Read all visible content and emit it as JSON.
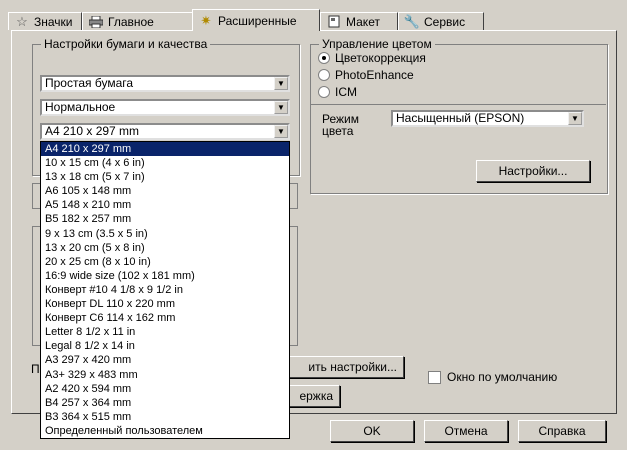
{
  "tabs": [
    {
      "label": "Значки",
      "icon": "star-icon"
    },
    {
      "label": "Главное",
      "icon": "printer-icon"
    },
    {
      "label": "Расширенные",
      "icon": "sparkle-icon"
    },
    {
      "label": "Макет",
      "icon": "page-layout-icon"
    },
    {
      "label": "Сервис",
      "icon": "wrench-icon"
    }
  ],
  "paper_group": {
    "title": "Настройки бумаги и качества",
    "media_type": "Простая бумага",
    "quality": "Нормальное",
    "paper_size": "A4 210 x 297 mm"
  },
  "color_group": {
    "title": "Управление цветом",
    "options": [
      "Цветокоррекция",
      "PhotoEnhance",
      "ICM"
    ],
    "selected": "Цветокоррекция",
    "mode_label_1": "Режим",
    "mode_label_2": "цвета",
    "mode_value": "Насыщенный (EPSON)",
    "settings_button": "Настройки..."
  },
  "paper_size_options": [
    "A4 210 x 297 mm",
    "10 x 15 cm (4 x 6 in)",
    "13 x 18 cm (5 x 7 in)",
    "A6 105 x 148 mm",
    "A5 148 x 210 mm",
    "B5 182 x 257 mm",
    "9 x 13 cm (3.5 x 5 in)",
    "13 x 20 cm (5 x 8 in)",
    "20 x 25 cm (8 x 10 in)",
    "16:9 wide size (102 x 181 mm)",
    "Конверт #10 4 1/8 x 9 1/2 in",
    "Конверт DL  110 x 220 mm",
    "Конверт C6  114 x 162 mm",
    "Letter 8 1/2 x 11 in",
    "Legal 8 1/2 x 14 in",
    "A3 297 x 420 mm",
    "A3+ 329 x 483 mm",
    "A2 420 x 594 mm",
    "B4 257 x 364 mm",
    "B3 364 x 515 mm",
    "Определенный пользователем"
  ],
  "selected_index": 0,
  "partial": {
    "save_settings": "ить настройки...",
    "support": "ержка",
    "left_letter": "П"
  },
  "default_checkbox": "Окно по умолчанию",
  "footer": {
    "ok": "OK",
    "cancel": "Отмена",
    "help": "Справка"
  },
  "colors": {
    "face": "#d4d0c8",
    "highlight": "#0a246a"
  }
}
